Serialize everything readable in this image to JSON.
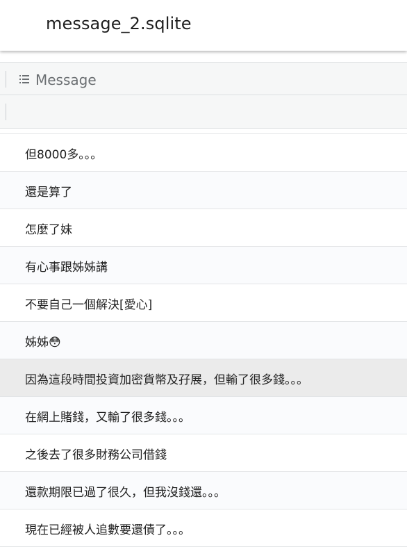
{
  "app": {
    "file_title": "message_2.sqlite"
  },
  "table": {
    "column_header": "Message",
    "column_icon": "list-icon",
    "rows": [
      "但8000多。。。",
      "還是算了",
      "怎麼了妹",
      "有心事跟姊姊講",
      "不要自己一個解決[愛心]",
      "姊姊😳",
      "因為這段時間投資加密貨幣及孖展，但輸了很多錢。。。",
      "在網上賭錢，又輸了很多錢。。。",
      "之後去了很多財務公司借錢",
      "還款期限已過了很久，但我沒錢還。。。",
      "現在已經被人追數要還債了。。。"
    ],
    "selected_row_index": 6
  },
  "colors": {
    "header_bg": "#f6f7f7",
    "selected_row_bg": "#ebebeb",
    "alt_row_bg": "#fafbfd",
    "divider": "#e3e5e7"
  }
}
